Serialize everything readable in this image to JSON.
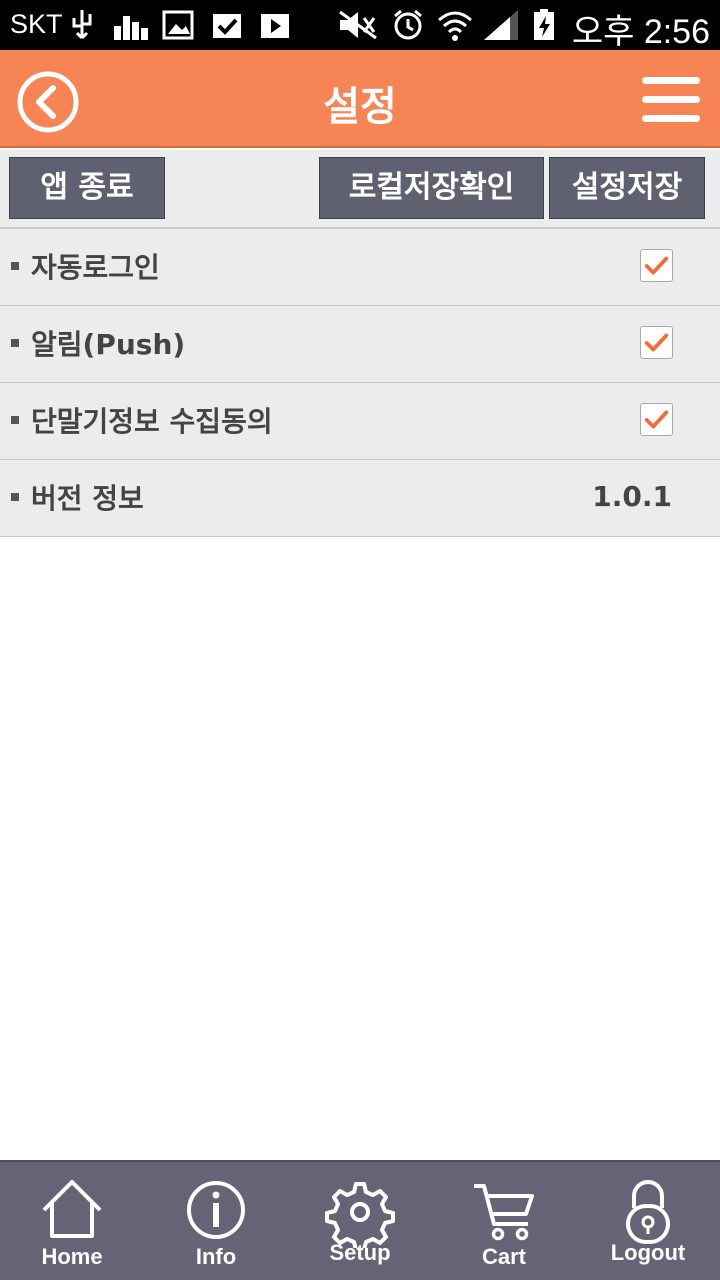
{
  "status_bar": {
    "carrier": "SKT",
    "time": "오후 2:56"
  },
  "header": {
    "title": "설정",
    "back_icon": "back-circle-icon",
    "menu_icon": "hamburger-menu-icon"
  },
  "toolbar": {
    "exit_label": "앱 종료",
    "local_check_label": "로컬저장확인",
    "save_label": "설정저장"
  },
  "settings": [
    {
      "label": "자동로그인",
      "type": "checkbox",
      "checked": true
    },
    {
      "label": "알림(Push)",
      "type": "checkbox",
      "checked": true
    },
    {
      "label": "단말기정보 수집동의",
      "type": "checkbox",
      "checked": true
    },
    {
      "label": "버전 정보",
      "type": "value",
      "value": "1.0.1"
    }
  ],
  "bottom_nav": {
    "home": "Home",
    "info": "Info",
    "setup": "Setup",
    "cart": "Cart",
    "logout": "Logout"
  },
  "colors": {
    "header": "#f78454",
    "checkmark": "#f26b3a",
    "button": "#5f6070",
    "nav": "#646476"
  }
}
